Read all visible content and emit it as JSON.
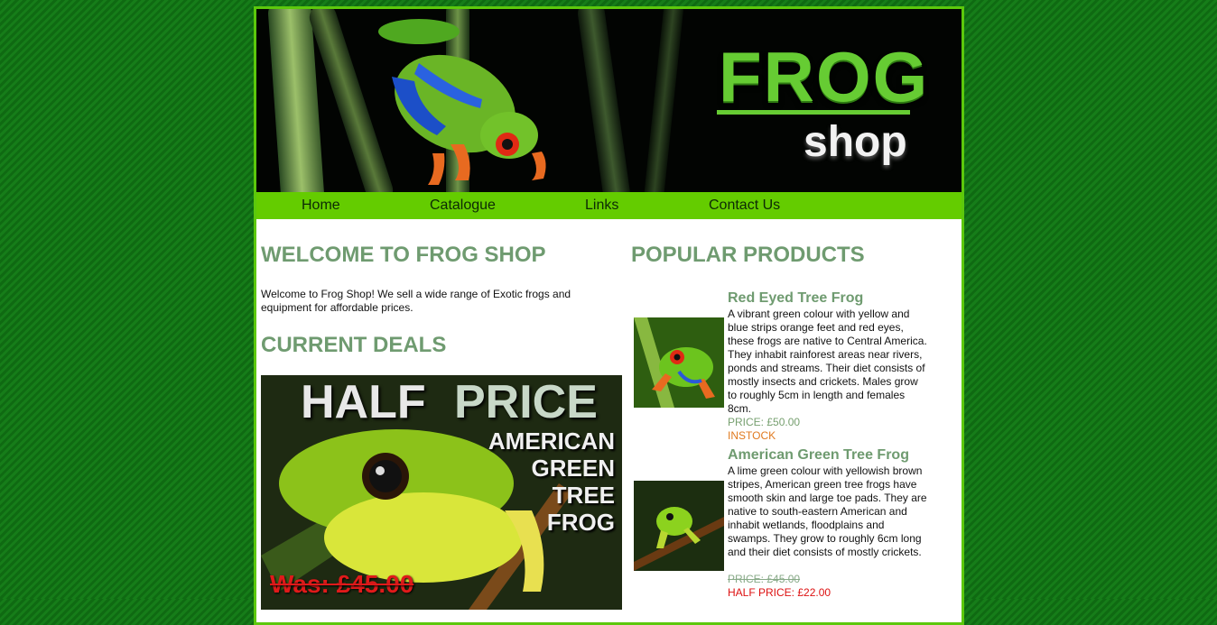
{
  "header": {
    "logo_main": "FROG",
    "logo_sub": "shop"
  },
  "nav": {
    "items": [
      "Home",
      "Catalogue",
      "Links",
      "Contact Us"
    ]
  },
  "welcome": {
    "title": "WELCOME TO FROG SHOP",
    "text": "Welcome to Frog Shop! We sell a wide range of Exotic frogs and equipment for affordable prices."
  },
  "deals": {
    "title": "CURRENT DEALS",
    "banner": {
      "headline_1": "HALF",
      "headline_2": "PRICE",
      "line_1": "AMERICAN",
      "line_2": "GREEN",
      "line_3": "TREE",
      "line_4": "FROG",
      "was": "Was: £45.00"
    }
  },
  "popular": {
    "title": "POPULAR PRODUCTS",
    "products": [
      {
        "name": "Red Eyed Tree Frog",
        "description": "A vibrant green colour with yellow and blue strips orange feet and red eyes, these frogs are native to Central America. They inhabit rainforest areas near rivers, ponds and streams. Their diet consists of mostly insects and crickets. Males grow to roughly 5cm in length and females 8cm.",
        "price": "PRICE: £50.00",
        "stock": "INSTOCK"
      },
      {
        "name": "American Green Tree Frog",
        "description": "A lime green colour with yellowish brown stripes, American green tree frogs have smooth skin and large toe pads. They are native to south-eastern American and inhabit wetlands, floodplains and swamps. They grow to roughly 6cm long and their diet consists of mostly crickets.",
        "was_price": "PRICE: £45.00",
        "half_price": "HALF PRICE: £22.00"
      }
    ]
  },
  "colors": {
    "background": "#0f6a12",
    "nav": "#64cc00",
    "heading": "#6f9b70",
    "stock": "#e07a20",
    "sale": "#dd1111"
  }
}
